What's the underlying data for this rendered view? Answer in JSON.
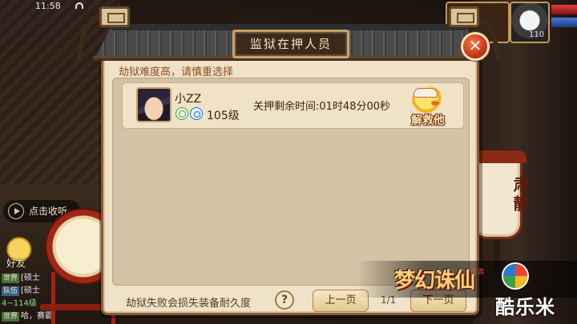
{
  "status_bar": {
    "time": "11:58"
  },
  "dialog": {
    "title": "监狱在押人员",
    "close_label": "✕",
    "hint_top": "劫狱难度高，请慎重选择",
    "hint_bottom": "劫狱失败会损失装备耐久度",
    "prisoners": [
      {
        "name": "小ZZ",
        "level": "105级",
        "remaining_time": "关押剩余时间:01时48分00秒",
        "rescue_label": "解救他"
      }
    ],
    "help_label": "?",
    "prev_label": "上一页",
    "page_indicator": "1/1",
    "next_label": "下一页"
  },
  "hud": {
    "level": "110"
  },
  "left_panel": {
    "listen_label": "点击收听",
    "friend_label": "好友",
    "chat": [
      {
        "tag": "世界",
        "text": "[硕士"
      },
      {
        "tag": "队伍",
        "text": "[硕士"
      },
      {
        "tag": "",
        "text": "4~114级"
      },
      {
        "tag": "世界",
        "text": "哈，赛霸!"
      }
    ]
  },
  "signboard": {
    "text": "肃静"
  },
  "branding": {
    "game_title": "梦幻诛仙",
    "game_sub": "手游",
    "watermark": "酷乐米"
  },
  "colors": {
    "panel_bg": "#efe2c8",
    "title_bg": "#3a2a1c",
    "close_red": "#c8361a"
  }
}
